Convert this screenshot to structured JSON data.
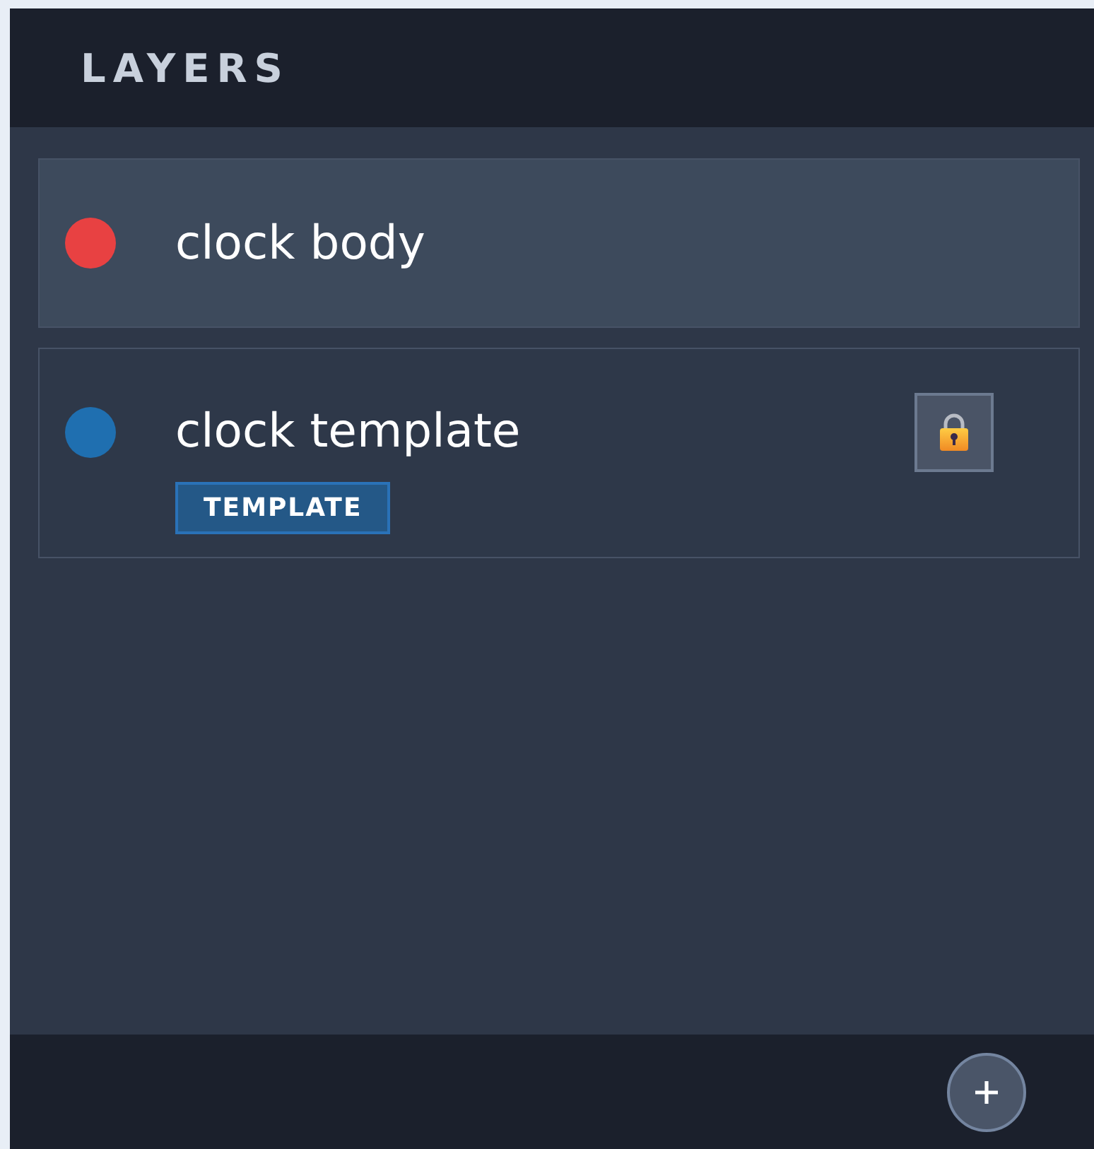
{
  "panel": {
    "title": "LAYERS"
  },
  "layers": [
    {
      "name": "clock body",
      "color": "#e84142",
      "selected": true,
      "locked": false
    },
    {
      "name": "clock template",
      "color": "#1f6fb0",
      "selected": false,
      "locked": true,
      "badge": "TEMPLATE"
    }
  ]
}
